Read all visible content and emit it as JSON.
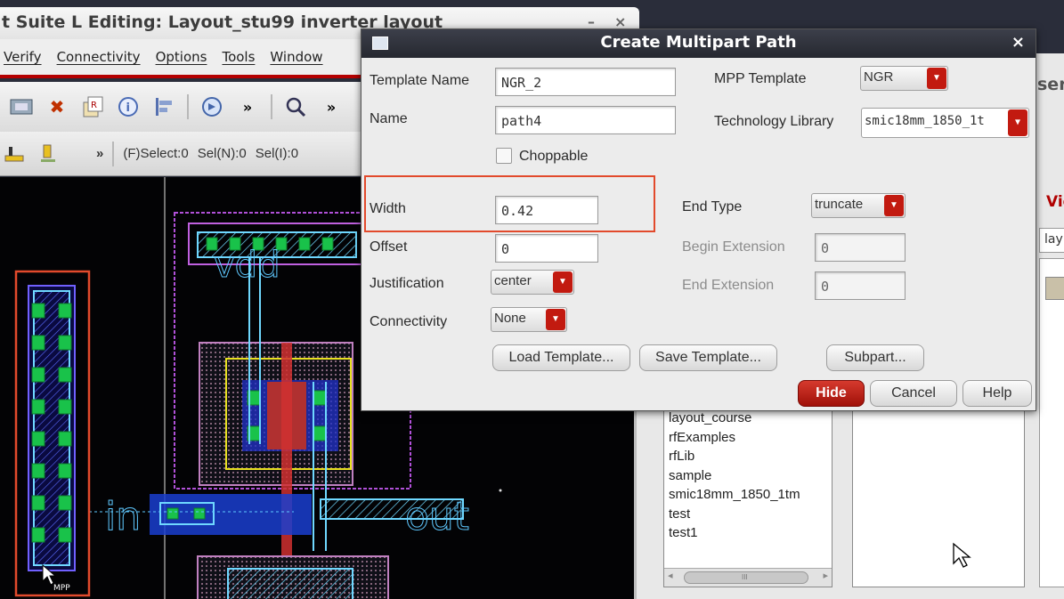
{
  "main_window": {
    "title": "t Suite L Editing: Layout_stu99 inverter layout",
    "menu": [
      "Verify",
      "Connectivity",
      "Options",
      "Tools",
      "Window"
    ],
    "status": [
      "(F)Select:0",
      "Sel(N):0",
      "Sel(I):0"
    ]
  },
  "dialog": {
    "title": "Create Multipart Path",
    "close_glyph": "×",
    "template_name_label": "Template Name",
    "template_name_value": "NGR_2",
    "name_label": "Name",
    "name_value": "path4",
    "choppable_label": "Choppable",
    "mpp_template_label": "MPP Template",
    "mpp_template_value": "NGR",
    "tech_library_label": "Technology Library",
    "tech_library_value": "smic18mm_1850_1t",
    "width_label": "Width",
    "width_value": "0.42",
    "offset_label": "Offset",
    "offset_value": "0",
    "justification_label": "Justification",
    "justification_value": "center",
    "connectivity_label": "Connectivity",
    "connectivity_value": "None",
    "end_type_label": "End Type",
    "end_type_value": "truncate",
    "begin_extension_label": "Begin Extension",
    "begin_extension_value": "0",
    "end_extension_label": "End Extension",
    "end_extension_value": "0",
    "buttons": {
      "load_template": "Load Template...",
      "save_template": "Save Template...",
      "subpart": "Subpart...",
      "hide": "Hide",
      "cancel": "Cancel",
      "help": "Help"
    }
  },
  "library_browser": {
    "partial_header": "ser",
    "partial_view": "Vie",
    "partial_field": "lay",
    "libraries": [
      "layout_course",
      "rfExamples",
      "rfLib",
      "sample",
      "smic18mm_1850_1tm",
      "test",
      "test1"
    ],
    "scroll_glyph": "III"
  },
  "canvas": {
    "pin_in": "in",
    "pin_out": "out",
    "pin_vdd": "vdd",
    "cursor_label": "MPP"
  },
  "colors": {
    "accent_red": "#c21a10",
    "highlight_box": "#e24a2c",
    "dialog_title_bg": "#2f323c"
  }
}
